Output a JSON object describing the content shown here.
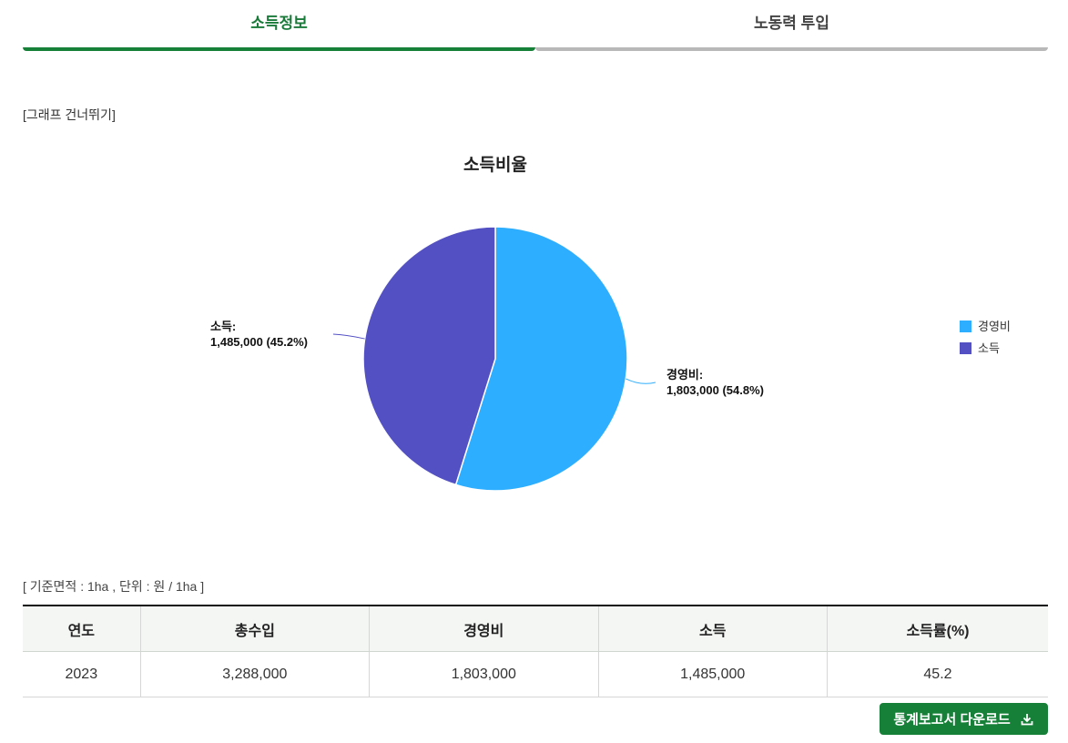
{
  "tabs": [
    {
      "label": "소득정보",
      "active": true
    },
    {
      "label": "노동력 투입",
      "active": false
    }
  ],
  "skip_link": "[그래프 건너뛰기]",
  "chart_data": {
    "type": "pie",
    "title": "소득비율",
    "slices": [
      {
        "name": "경영비",
        "value": 1803000,
        "percent": 54.8,
        "label_name": "경영비:",
        "label_value": "1,803,000 (54.8%)",
        "color": "#2eaeff"
      },
      {
        "name": "소득",
        "value": 1485000,
        "percent": 45.2,
        "label_name": "소득:",
        "label_value": "1,485,000 (45.2%)",
        "color": "#5350c4"
      }
    ],
    "legend_placement": "right"
  },
  "basis_note": "[ 기준면적 : 1ha , 단위 : 원 / 1ha ]",
  "table": {
    "headers": [
      "연도",
      "총수입",
      "경영비",
      "소득",
      "소득률(%)"
    ],
    "rows": [
      [
        "2023",
        "3,288,000",
        "1,803,000",
        "1,485,000",
        "45.2"
      ]
    ]
  },
  "download_button": "통계보고서 다운로드",
  "colors": {
    "accent": "#178038"
  }
}
